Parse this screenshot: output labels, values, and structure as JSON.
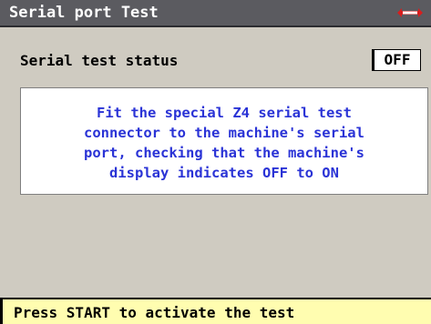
{
  "window": {
    "title": "Serial port Test",
    "logo_icon": "silca-logo-icon"
  },
  "status": {
    "label": "Serial test status",
    "value": "OFF"
  },
  "instructions": {
    "lines": [
      "Fit the special Z4 serial test",
      "connector to the machine's serial",
      "port, checking that the machine's",
      "display indicates OFF to ON"
    ]
  },
  "footer": {
    "message": "Press START to activate the test"
  },
  "colors": {
    "titlebar": "#5b5b60",
    "background": "#cfcbc1",
    "instruction_text": "#2a33d6",
    "footer_background": "#fffdb0",
    "logo_red": "#d81e1e"
  }
}
